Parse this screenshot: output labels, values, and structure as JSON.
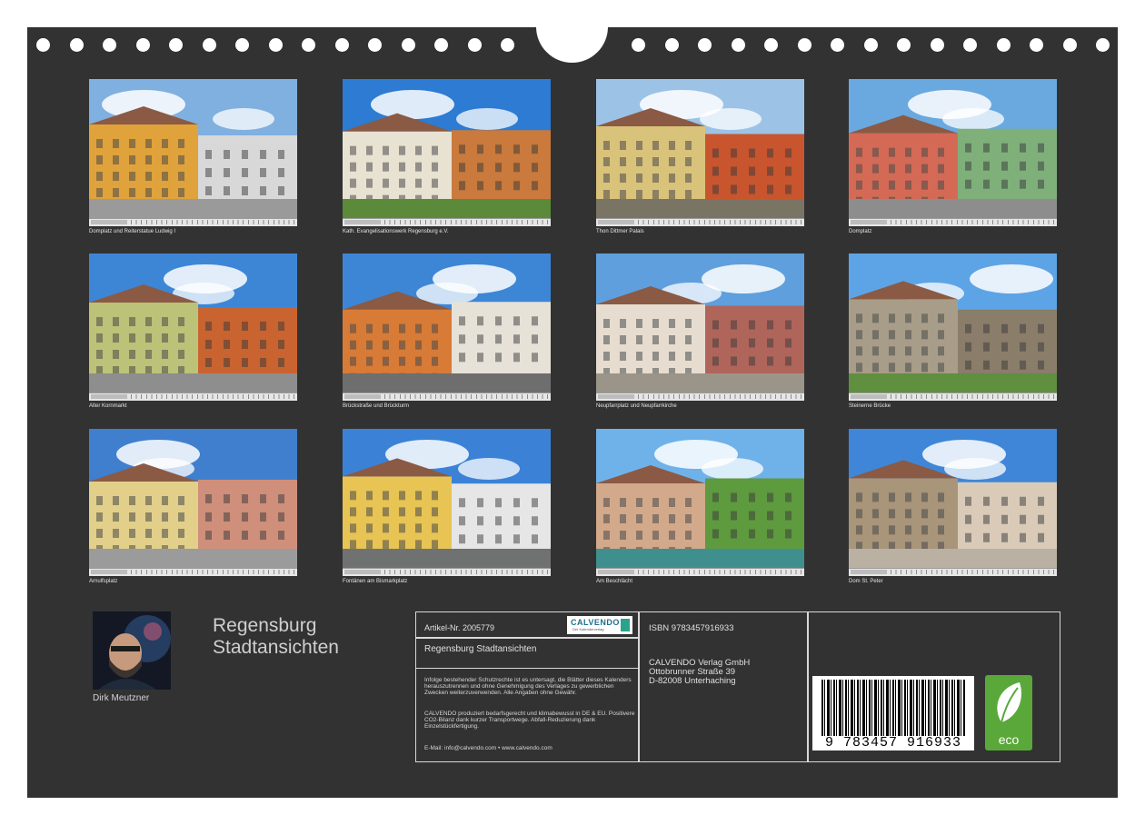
{
  "photos": [
    {
      "caption": "Domplatz und Reiterstatue Ludwig I",
      "month": "Januar",
      "sky": "#7fb0e0",
      "bldg": "#e0a23a",
      "ground": "#9a9a9a",
      "accent": "#d8d8d8"
    },
    {
      "caption": "Kath. Evangelisationswerk Regensburg e.V.",
      "month": "Februar",
      "sky": "#2d7bd2",
      "bldg": "#e8e2d2",
      "ground": "#5b8a3a",
      "accent": "#c97a3c"
    },
    {
      "caption": "Thon Dittmer Palais",
      "month": "März",
      "sky": "#9cc3e6",
      "bldg": "#d9c27a",
      "ground": "#7a7464",
      "accent": "#c8552e"
    },
    {
      "caption": "Domplatz",
      "month": "April",
      "sky": "#6aa8e0",
      "bldg": "#d46a55",
      "ground": "#8d8d8d",
      "accent": "#7fb07a"
    },
    {
      "caption": "Alter Kornmarkt",
      "month": "Mai",
      "sky": "#3d86d6",
      "bldg": "#bcc277",
      "ground": "#8e8e8e",
      "accent": "#c9632f"
    },
    {
      "caption": "Brückstraße und Brückturm",
      "month": "Juni",
      "sky": "#3d86d6",
      "bldg": "#d77b37",
      "ground": "#6e6e6e",
      "accent": "#e7e2d8"
    },
    {
      "caption": "Neupfarrplatz und Neupfarrkirche",
      "month": "Juli",
      "sky": "#5f9fdd",
      "bldg": "#e6ddd0",
      "ground": "#9b9488",
      "accent": "#b0655a"
    },
    {
      "caption": "Steinerne Brücke",
      "month": "August",
      "sky": "#5da4e6",
      "bldg": "#a89d88",
      "ground": "#5f8f3f",
      "accent": "#8a7d6a"
    },
    {
      "caption": "Arnulfsplatz",
      "month": "September",
      "sky": "#3f7fce",
      "bldg": "#e2cf8a",
      "ground": "#9b9b9b",
      "accent": "#cf8f7a"
    },
    {
      "caption": "Fontänen am Bismarkplatz",
      "month": "Oktober",
      "sky": "#3b82d6",
      "bldg": "#e7c454",
      "ground": "#6f7270",
      "accent": "#e6e6e6"
    },
    {
      "caption": "Am Beschlächt",
      "month": "November",
      "sky": "#6fb2ea",
      "bldg": "#d2a98a",
      "ground": "#3f8f8f",
      "accent": "#5e9a3e"
    },
    {
      "caption": "Dom St. Peter",
      "month": "Dezember",
      "sky": "#3f86d8",
      "bldg": "#a8957a",
      "ground": "#bbb1a2",
      "accent": "#d9cbb8"
    }
  ],
  "author": {
    "name": "Dirk Meutzner"
  },
  "title": {
    "line1": "Regensburg",
    "line2": "Stadtansichten"
  },
  "info": {
    "article": "Artikel-Nr. 2005779",
    "logo": "CALVENDO",
    "logo_sub": "Der Kalenderverlag",
    "product_title": "Regensburg Stadtansichten",
    "legal": "Infolge bestehender Schutzrechte ist es untersagt, die Blätter dieses Kalenders herauszutrennen und ohne Genehmigung des Verlages zu gewerblichen Zwecken weiterzuverwenden. Alle Angaben ohne Gewähr.",
    "eco_note": "CALVENDO produziert bedarfsgerecht und klimabewusst in DE & EU. Positivere CO2-Bilanz dank kurzer Transportwege. Abfall-Reduzierung dank Einzelstückfertigung.",
    "contact": "E-Mail: info@calvendo.com • www.calvendo.com",
    "isbn": "ISBN 9783457916933",
    "publisher_name": "CALVENDO Verlag GmbH",
    "publisher_street": "Ottobrunner Straße 39",
    "publisher_city": "D-82008 Unterhaching",
    "barcode_digits": "9 783457 916933",
    "eco_label": "eco"
  }
}
